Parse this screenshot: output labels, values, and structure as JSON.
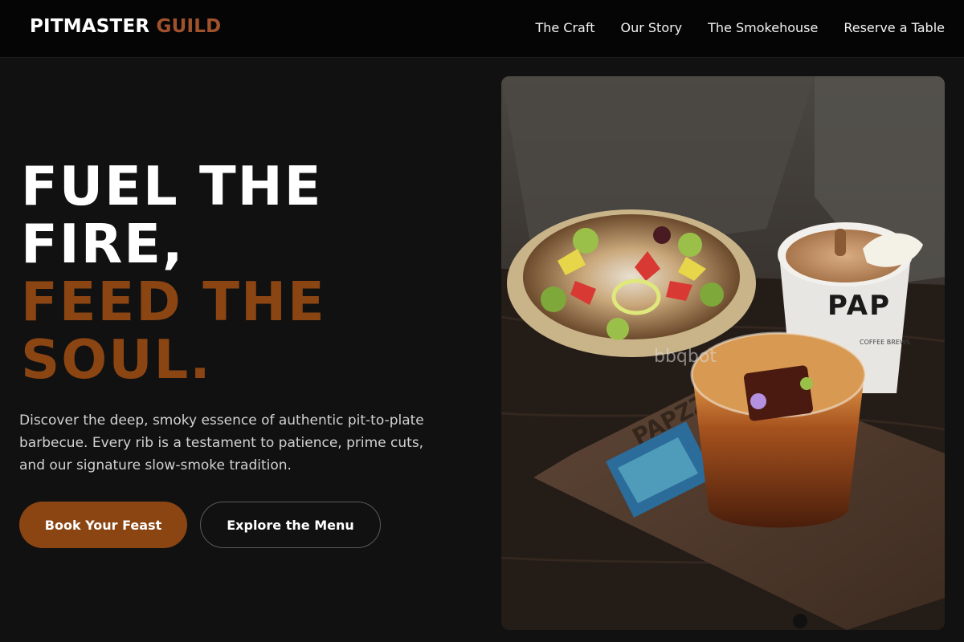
{
  "brand": {
    "name_main": "PITMASTER",
    "name_accent": "GUILD",
    "accent_color": "#a0522d"
  },
  "nav": {
    "links": [
      "The Craft",
      "Our Story",
      "The Smokehouse",
      "Reserve a Table"
    ]
  },
  "hero": {
    "title_line1": "FUEL THE",
    "title_line2": "FIRE,",
    "title_line3": "FEED THE",
    "title_line4": "SOUL.",
    "title_accent_color": "#8b4513",
    "description": "Discover the deep, smoky essence of authentic pit-to-plate barbecue. Every rib is a testament to patience, prime cuts, and our signature slow-smoke tradition.",
    "primary_button": "Book Your Feast",
    "secondary_button": "Explore the Menu"
  },
  "image": {
    "cup_brand": "PAP",
    "cup_sub": "COFFEE BREWS",
    "tray_brand": "PAPZZ",
    "watermark": "bbqbot"
  }
}
